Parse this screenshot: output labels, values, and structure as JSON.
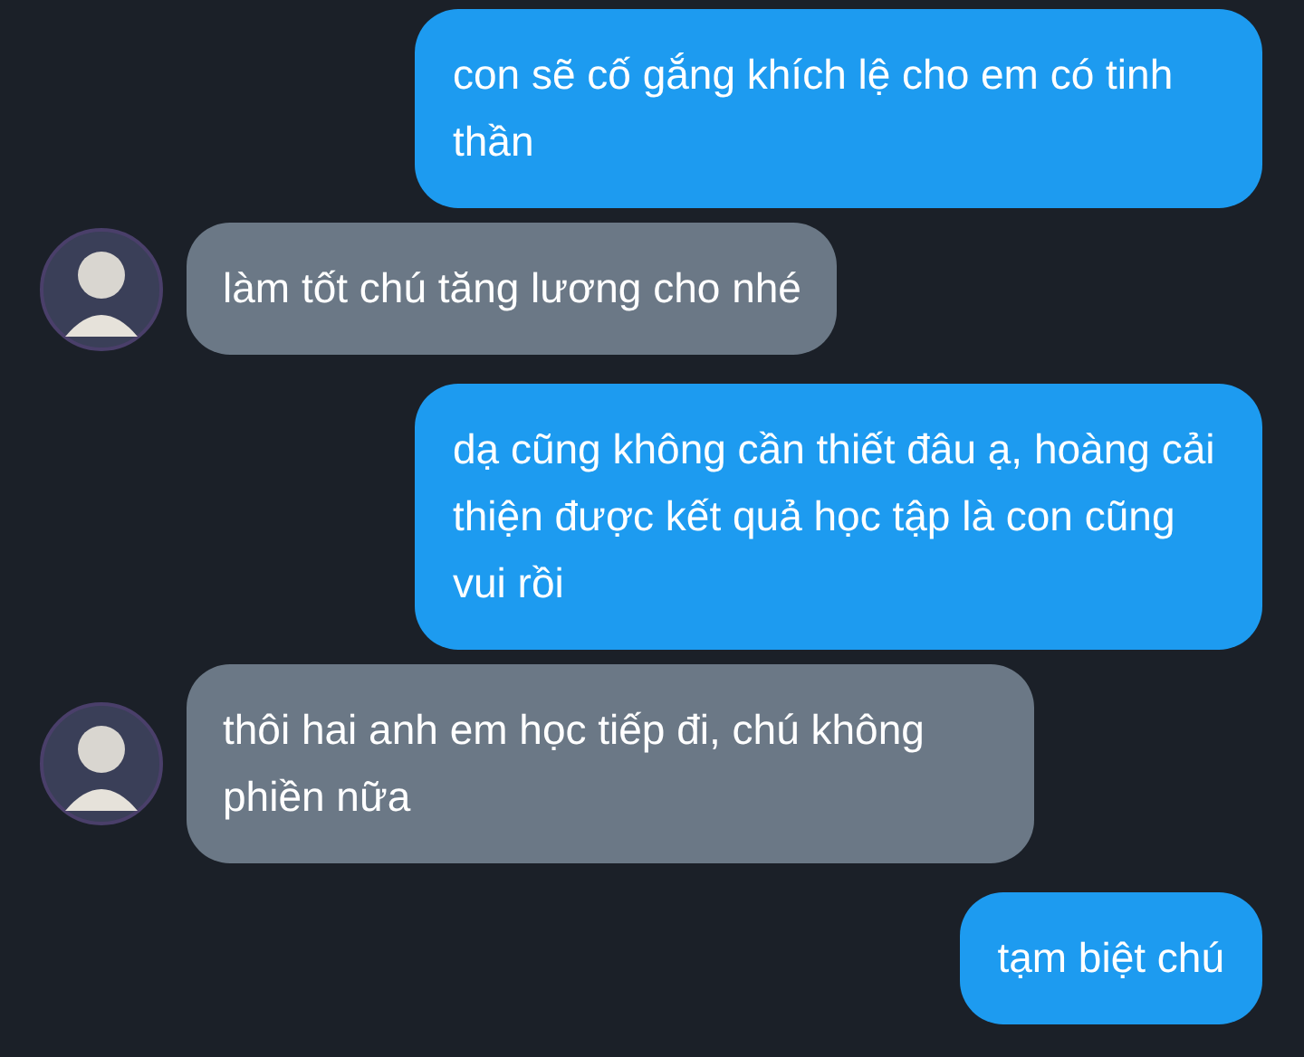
{
  "messages": [
    {
      "kind": "sent",
      "text": "con sẽ cố gắng khích lệ cho em có tinh thần"
    },
    {
      "kind": "received",
      "text": "làm tốt chú tăng lương cho nhé"
    },
    {
      "kind": "sent",
      "text": "dạ cũng không cần thiết đâu ạ, hoàng cải thiện được kết quả học tập là con cũng vui rồi"
    },
    {
      "kind": "received",
      "text": "thôi hai anh em học tiếp đi, chú không phiền nữa"
    },
    {
      "kind": "sent",
      "text": "tạm biệt chú"
    }
  ]
}
